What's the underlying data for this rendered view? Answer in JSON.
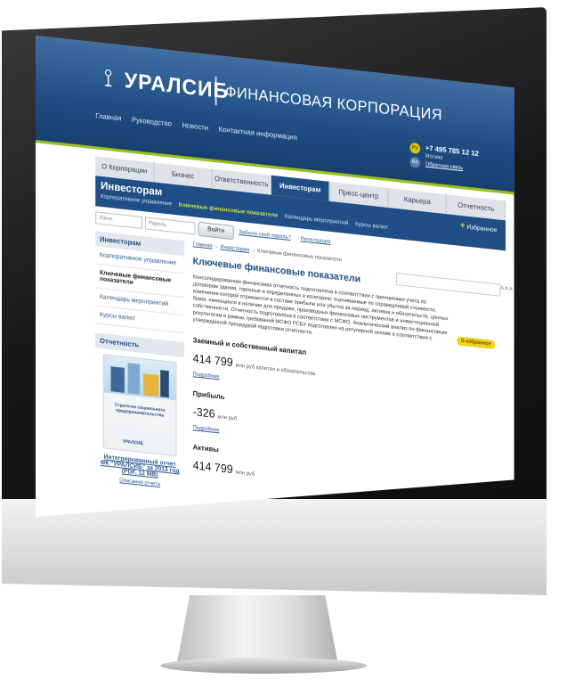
{
  "header": {
    "logo_icon": "uralsib-logo-icon",
    "brand": "УРАЛСИБ",
    "tagline": "ФИНАНСОВАЯ КОРПОРАЦИЯ",
    "top_nav": [
      "Главная",
      "Руководство",
      "Новости",
      "Контактная информация"
    ],
    "lang_ru": "Ру",
    "lang_en": "En",
    "phone": "+7 495 785 12 12",
    "city": "Москва",
    "feedback": "Обратная связь"
  },
  "tabs": [
    {
      "label": "О Корпорации"
    },
    {
      "label": "Бизнес"
    },
    {
      "label": "Ответственность"
    },
    {
      "label": "Инвесторам"
    },
    {
      "label": "Пресс-центр"
    },
    {
      "label": "Карьера"
    },
    {
      "label": "Отчетность"
    }
  ],
  "subbar": {
    "title": "Инвесторам",
    "links": [
      "Корпоративное управление",
      "Ключевые финансовые показатели",
      "Календарь мероприятий",
      "Курсы валют"
    ],
    "favorites_plus": "+",
    "favorites": "Избранное"
  },
  "login": {
    "login_placeholder": "Логин",
    "password_placeholder": "Пароль",
    "button": "Войти",
    "forgot": "Забыли свой пароль?",
    "register": "Регистрация"
  },
  "sidebar": {
    "header": "Инвесторам",
    "items": [
      {
        "label": "Корпоративное управление"
      },
      {
        "label": "Ключевые финансовые показатели"
      },
      {
        "label": "Календарь мероприятий"
      },
      {
        "label": "Курсы валют"
      }
    ],
    "report_header": "Отчетность",
    "cover_title": "Стратегия социального предпринимательства",
    "cover_logo": "УРАЛСИБ",
    "report_caption": "Интегрированный отчет ФК \"УРАЛСИБ\" за 2013 год (PDF, 12 MB)",
    "report_more": "Описание отчета"
  },
  "main": {
    "crumbs": {
      "home": "Главная",
      "section": "Инвесторам",
      "current": "Ключевые финансовые показатели"
    },
    "title": "Ключевые финансовые показатели",
    "font_controls": "A A A",
    "intro": "Консолидированная финансовая отчетность подготовлена в соответствии с принципами учета по договорам здания, торговые и определенных в категорию: оцениваемые по справедливой стоимости, изменения которой отражаются в составе прибыли или убытка за период, активов и обязательств, ценных бумаг, имеющихся в наличии для продажи, производных финансовых инструментов и инвестиционной собственности. Отчетность подготовлена в соответствии с МСФО. Аналитический анализ по финансовым результатам в рамках требований МСФО РСБУ подготовлен на регулярной основе в соответствии с утвержденной процедурой подготовки отчетности.",
    "badge": "В избранное",
    "metrics": [
      {
        "title": "Заемный и собственный капитал",
        "value": "414 799",
        "unit": "млн руб капитал и обязательства",
        "more": "Подробнее"
      },
      {
        "title": "Прибыль",
        "value": "-326",
        "unit": "млн руб",
        "more": "Подробнее"
      },
      {
        "title": "Активы",
        "value": "414 799",
        "unit": "млн руб",
        "more": ""
      }
    ]
  }
}
